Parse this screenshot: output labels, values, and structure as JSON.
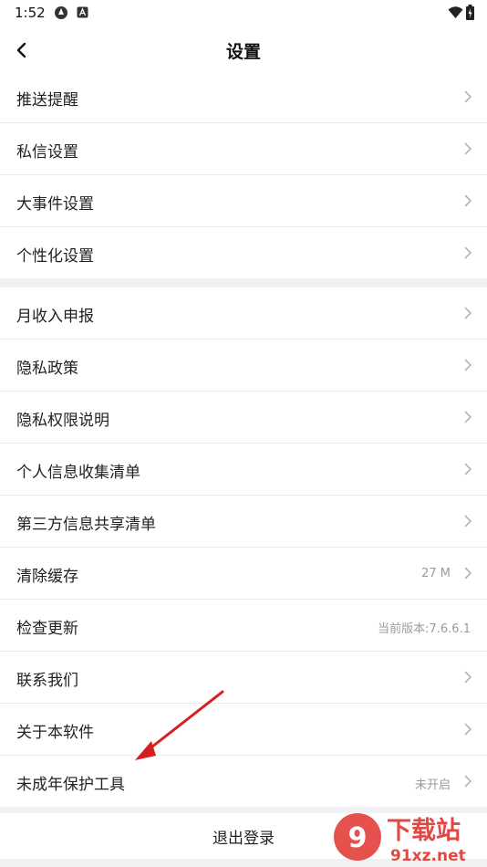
{
  "status_bar": {
    "time": "1:52"
  },
  "header": {
    "title": "设置"
  },
  "group1": [
    {
      "label": "推送提醒"
    },
    {
      "label": "私信设置"
    },
    {
      "label": "大事件设置"
    },
    {
      "label": "个性化设置"
    }
  ],
  "group2": [
    {
      "label": "月收入申报",
      "value": ""
    },
    {
      "label": "隐私政策",
      "value": ""
    },
    {
      "label": "隐私权限说明",
      "value": ""
    },
    {
      "label": "个人信息收集清单",
      "value": ""
    },
    {
      "label": "第三方信息共享清单",
      "value": ""
    },
    {
      "label": "清除缓存",
      "value": "27 M"
    },
    {
      "label": "检查更新",
      "value": "当前版本:7.6.6.1"
    },
    {
      "label": "联系我们",
      "value": ""
    },
    {
      "label": "关于本软件",
      "value": ""
    },
    {
      "label": "未成年保护工具",
      "value": "未开启"
    }
  ],
  "logout": {
    "label": "退出登录"
  },
  "watermark": {
    "brand": "下载站",
    "domain": "91xz.net"
  },
  "colors": {
    "annotation_arrow": "#d81e1e",
    "watermark_red": "#e0342f"
  }
}
